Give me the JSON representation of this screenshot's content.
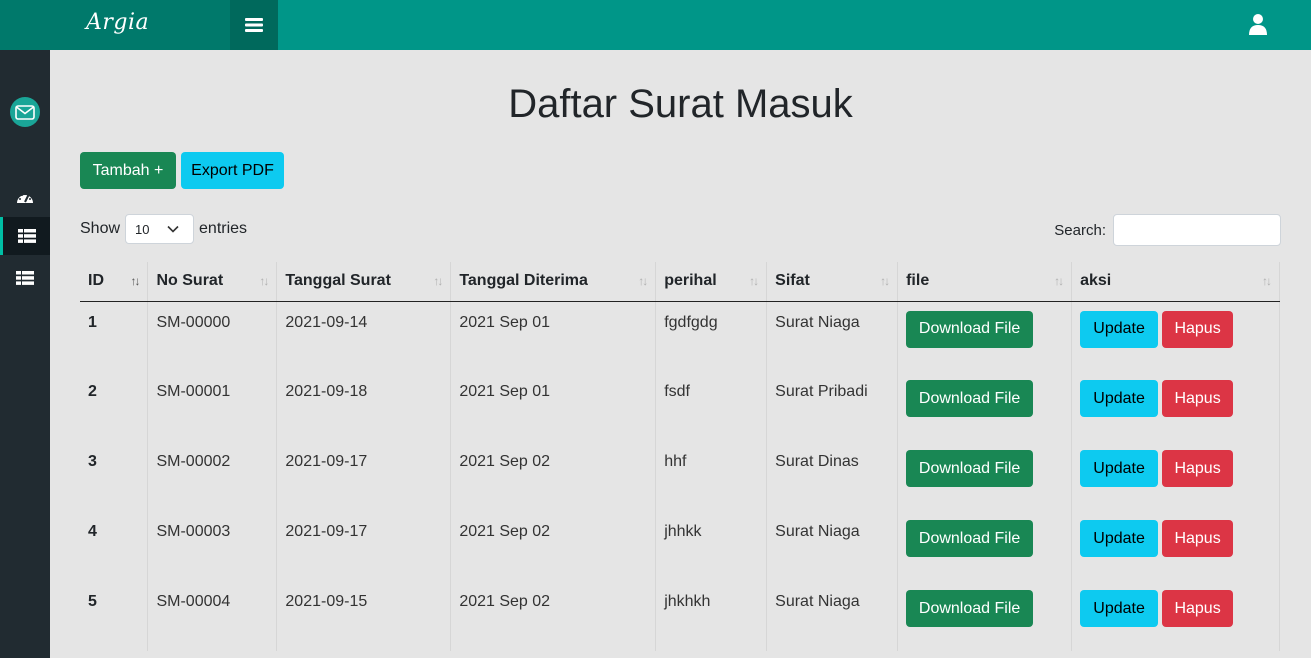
{
  "app": {
    "brand": "Argia"
  },
  "page": {
    "title": "Daftar Surat Masuk"
  },
  "toolbar": {
    "add_label": "Tambah +",
    "export_label": "Export PDF"
  },
  "length_menu": {
    "prefix": "Show",
    "selected": "10",
    "suffix": "entries"
  },
  "search": {
    "label": "Search:",
    "value": ""
  },
  "table": {
    "columns": [
      "ID",
      "No Surat",
      "Tanggal Surat",
      "Tanggal Diterima",
      "perihal",
      "Sifat",
      "file",
      "aksi"
    ],
    "download_label": "Download File",
    "update_label": "Update",
    "delete_label": "Hapus",
    "rows": [
      {
        "id": "1",
        "no_surat": "SM-00000",
        "tanggal_surat": "2021-09-14",
        "tanggal_diterima": "2021 Sep 01",
        "perihal": "fgdfgdg",
        "sifat": "Surat Niaga"
      },
      {
        "id": "2",
        "no_surat": "SM-00001",
        "tanggal_surat": "2021-09-18",
        "tanggal_diterima": "2021 Sep 01",
        "perihal": "fsdf",
        "sifat": "Surat Pribadi"
      },
      {
        "id": "3",
        "no_surat": "SM-00002",
        "tanggal_surat": "2021-09-17",
        "tanggal_diterima": "2021 Sep 02",
        "perihal": "hhf",
        "sifat": "Surat Dinas"
      },
      {
        "id": "4",
        "no_surat": "SM-00003",
        "tanggal_surat": "2021-09-17",
        "tanggal_diterima": "2021 Sep 02",
        "perihal": "jhhkk",
        "sifat": "Surat Niaga"
      },
      {
        "id": "5",
        "no_surat": "SM-00004",
        "tanggal_surat": "2021-09-15",
        "tanggal_diterima": "2021 Sep 02",
        "perihal": "jhkhkh",
        "sifat": "Surat Niaga"
      }
    ]
  },
  "colors": {
    "topbar": "#009688",
    "sidebar": "#212b31",
    "success": "#198754",
    "info": "#0dcaf0",
    "danger": "#dc3545"
  },
  "icons": {
    "user": "user-icon",
    "menu": "hamburger-icon",
    "mail": "envelope-icon",
    "dashboard": "dashboard-icon",
    "list": "table-list-icon",
    "sort": "sort-arrows-icon"
  }
}
